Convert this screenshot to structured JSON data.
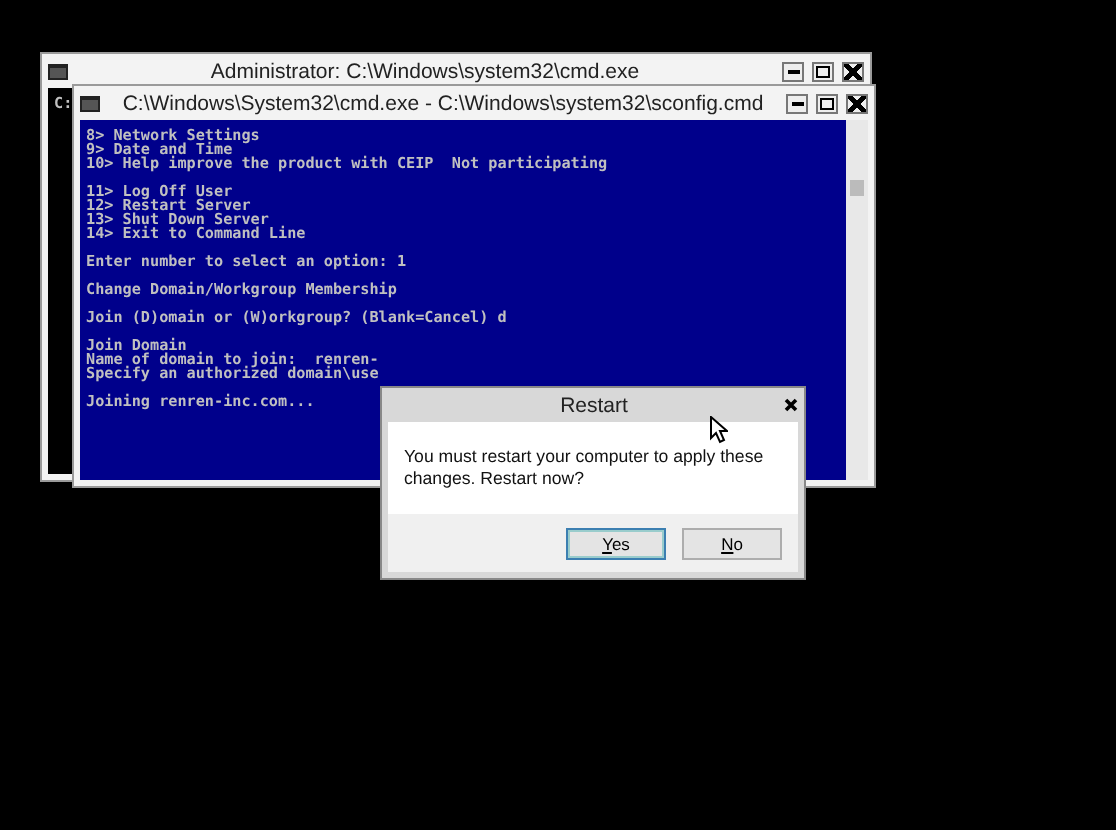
{
  "back_window": {
    "title": "Administrator: C:\\Windows\\system32\\cmd.exe",
    "console_text": "C:"
  },
  "front_window": {
    "title": "C:\\Windows\\System32\\cmd.exe - C:\\Windows\\system32\\sconfig.cmd",
    "groups": [
      [
        "8> Network Settings",
        "9> Date and Time",
        "10> Help improve the product with CEIP  Not participating"
      ],
      [
        "11> Log Off User",
        "12> Restart Server",
        "13> Shut Down Server",
        "14> Exit to Command Line"
      ],
      [
        "Enter number to select an option: 1"
      ],
      [
        "Change Domain/Workgroup Membership"
      ],
      [
        "Join (D)omain or (W)orkgroup? (Blank=Cancel) d"
      ],
      [
        "Join Domain",
        "Name of domain to join:  renren-",
        "Specify an authorized domain\\use"
      ],
      [
        "Joining renren-inc.com..."
      ]
    ]
  },
  "dialog": {
    "title": "Restart",
    "message": "You must restart your computer to apply these changes. Restart now?",
    "buttons": [
      {
        "label": "Yes",
        "selected": true
      },
      {
        "label": "No",
        "selected": false
      }
    ]
  }
}
